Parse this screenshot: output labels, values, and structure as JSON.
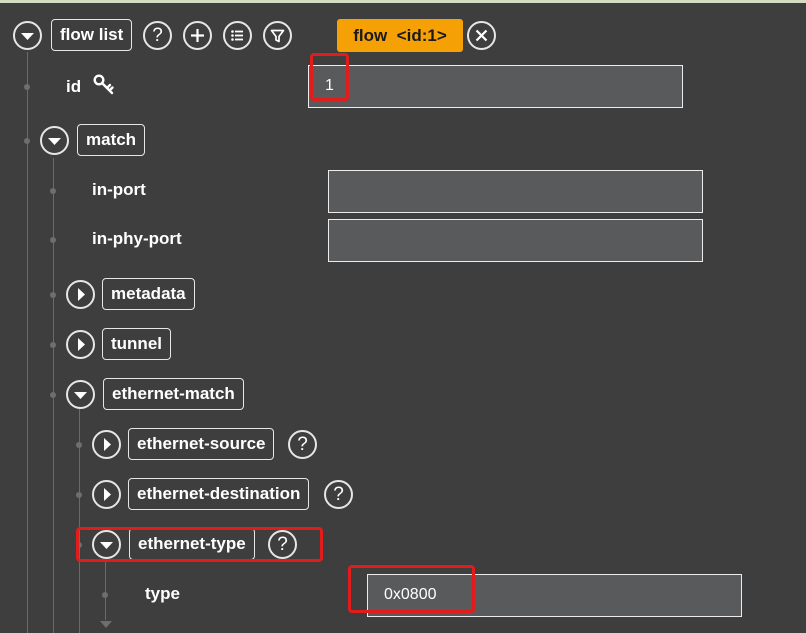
{
  "toolbar": {
    "root_label": "flow list",
    "tag_label": "flow  <id:1>"
  },
  "fields": {
    "id": {
      "label": "id",
      "value": "1"
    },
    "in_port": {
      "label": "in-port",
      "value": ""
    },
    "in_phy_port": {
      "label": "in-phy-port",
      "value": ""
    },
    "type": {
      "label": "type",
      "value": "0x0800"
    }
  },
  "nodes": {
    "match": "match",
    "metadata": "metadata",
    "tunnel": "tunnel",
    "ethernet_match": "ethernet-match",
    "ethernet_source": "ethernet-source",
    "ethernet_destination": "ethernet-destination",
    "ethernet_type": "ethernet-type"
  },
  "icons": {
    "help": "?",
    "expanded": "chevron-down-icon",
    "collapsed": "chevron-right-icon",
    "key": "key-icon",
    "add": "plus-icon",
    "list": "list-icon",
    "filter": "filter-icon",
    "close": "close-icon"
  },
  "colors": {
    "background": "#3e3e3e",
    "accent": "#f5a106",
    "highlight": "#e21b1b",
    "field_bg": "#595a5c"
  }
}
